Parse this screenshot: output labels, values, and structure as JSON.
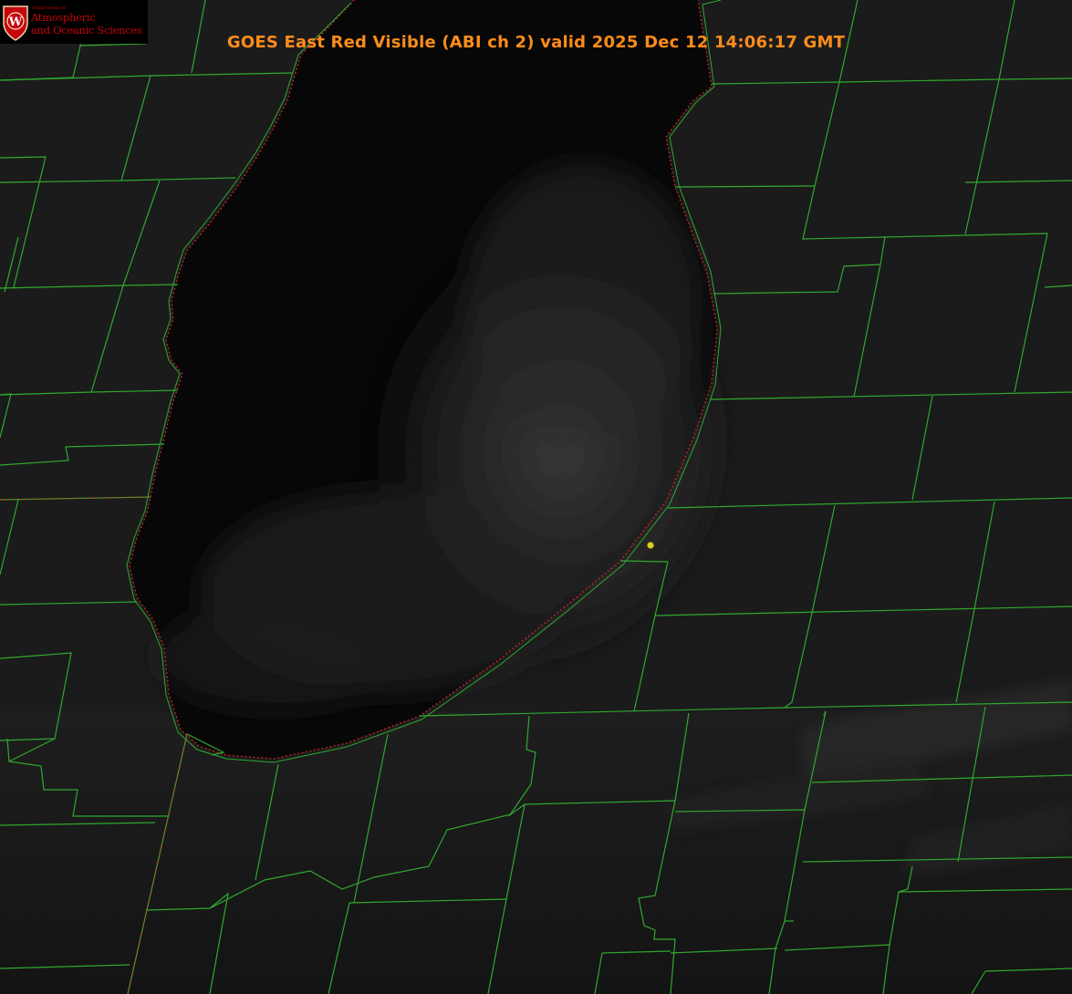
{
  "title": "GOES East Red Visible (ABI ch 2) valid 2025 Dec 12 14:06:17 GMT",
  "logo": {
    "department": "Department of",
    "line1": "Atmospheric",
    "line2": "and Oceanic Sciences",
    "shield_letter": "W"
  },
  "colors": {
    "title": "#ff8c1a",
    "boundaries": "#2fa82f",
    "shoreline_dots": "#ff2020",
    "marker": "#d8d020",
    "logo_red": "#c5050c"
  },
  "layers": [
    "visible-satellite-imagery",
    "county-boundaries",
    "state-boundaries",
    "lake-shoreline"
  ],
  "marker": {
    "type": "yellow-dot"
  }
}
